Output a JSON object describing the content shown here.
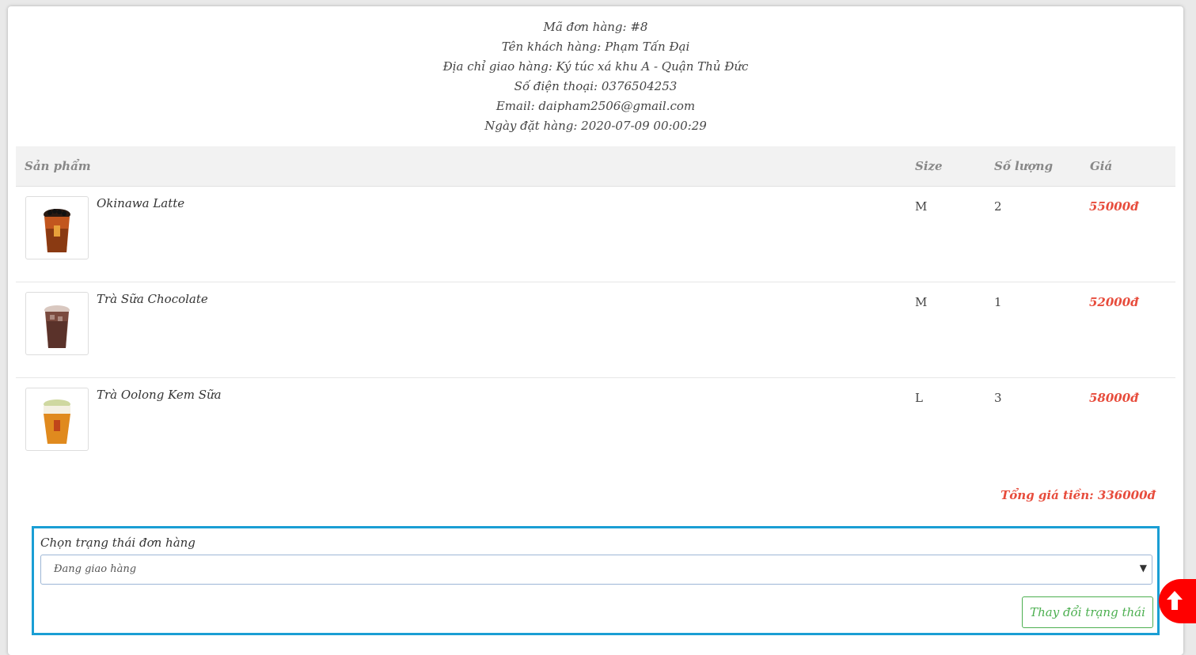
{
  "order": {
    "id_line": "Mã đơn hàng: #8",
    "customer_line": "Tên khách hàng: Phạm Tấn Đại",
    "address_line": "Địa chỉ giao hàng: Ký túc xá khu A - Quận Thủ Đức",
    "phone_line": "Số điện thoại: 0376504253",
    "email_line": "Email: daipham2506@gmail.com",
    "date_line": "Ngày đặt hàng: 2020-07-09 00:00:29"
  },
  "table": {
    "headers": {
      "product": "Sản phẩm",
      "size": "Size",
      "quantity": "Số lượng",
      "price": "Giá"
    },
    "rows": [
      {
        "name": "Okinawa Latte",
        "size": "M",
        "quantity": "2",
        "price": "55000đ",
        "image": "okinawa-latte-cup"
      },
      {
        "name": "Trà Sữa Chocolate",
        "size": "M",
        "quantity": "1",
        "price": "52000đ",
        "image": "chocolate-milk-tea-cup"
      },
      {
        "name": "Trà Oolong Kem Sữa",
        "size": "L",
        "quantity": "3",
        "price": "58000đ",
        "image": "oolong-cream-tea-cup"
      }
    ]
  },
  "total": "Tổng giá tiền: 336000đ",
  "status": {
    "label": "Chọn trạng thái đơn hàng",
    "selected": "Đang giao hàng",
    "button": "Thay đổi trạng thái"
  },
  "colors": {
    "accent_red": "#e74c3c",
    "focus_blue": "#1a9ed4",
    "button_green": "#4caf50",
    "scroll_button": "#ff0000"
  },
  "icons": {
    "dropdown": "caret-down-icon",
    "scroll_top": "arrow-up-icon"
  }
}
